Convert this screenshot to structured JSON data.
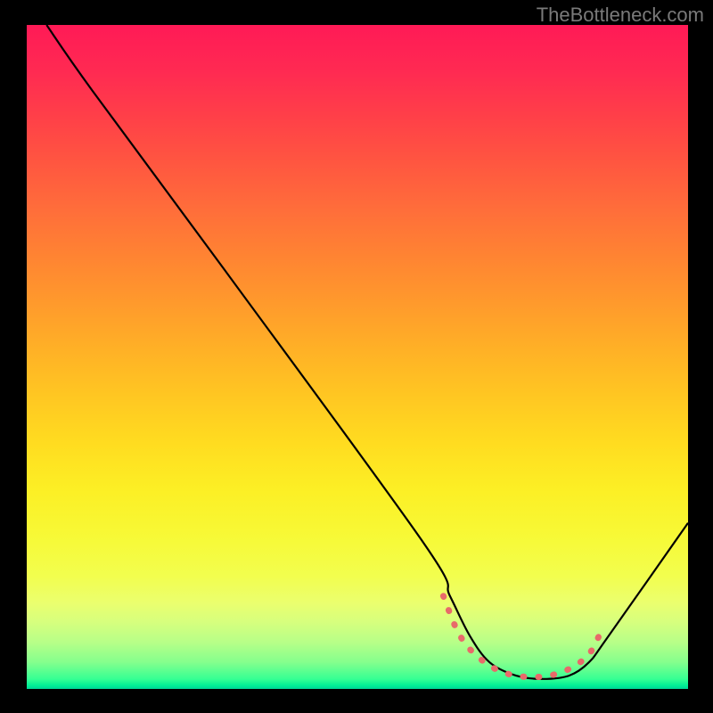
{
  "watermark": "TheBottleneck.com",
  "chart_data": {
    "type": "line",
    "title": "",
    "xlabel": "",
    "ylabel": "",
    "xlim": [
      0,
      100
    ],
    "ylim": [
      0,
      100
    ],
    "grid": false,
    "legend": false,
    "series": [
      {
        "name": "main-curve",
        "color": "#000000",
        "x": [
          3,
          10,
          30,
          60,
          64,
          67,
          70,
          74,
          78,
          82,
          85,
          88,
          100
        ],
        "y": [
          100,
          90,
          63,
          22,
          14,
          8,
          4,
          2,
          1.5,
          2,
          4,
          8,
          25
        ]
      },
      {
        "name": "bottom-highlight",
        "color": "#e86a6a",
        "x": [
          63,
          65,
          67,
          70,
          73,
          76,
          79,
          82,
          85,
          87
        ],
        "y": [
          14,
          9,
          6,
          3.5,
          2.2,
          1.8,
          2,
          3,
          5.2,
          9
        ]
      }
    ],
    "background_gradient": {
      "top": "#ff1a56",
      "mid": "#ffe122",
      "bottom": "#00d396"
    }
  }
}
